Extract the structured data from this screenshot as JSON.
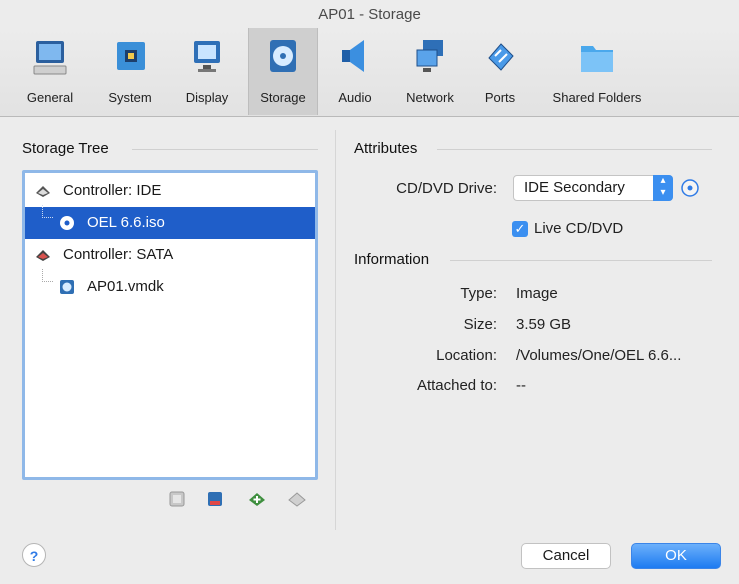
{
  "window": {
    "title": "AP01 - Storage"
  },
  "toolbar": {
    "items": [
      {
        "label": "General",
        "icon": "monitor-general-icon"
      },
      {
        "label": "System",
        "icon": "chip-icon"
      },
      {
        "label": "Display",
        "icon": "display-icon"
      },
      {
        "label": "Storage",
        "icon": "disk-icon",
        "active": true
      },
      {
        "label": "Audio",
        "icon": "speaker-icon"
      },
      {
        "label": "Network",
        "icon": "network-icon"
      },
      {
        "label": "Ports",
        "icon": "plug-icon"
      },
      {
        "label": "Shared Folders",
        "icon": "folder-icon"
      }
    ]
  },
  "storage_tree": {
    "heading": "Storage Tree",
    "rows": [
      {
        "label": "Controller: IDE",
        "icon": "ide-controller-icon"
      },
      {
        "label": "OEL 6.6.iso",
        "icon": "optical-disc-icon",
        "selected": true
      },
      {
        "label": "Controller: SATA",
        "icon": "sata-controller-icon"
      },
      {
        "label": "AP01.vmdk",
        "icon": "hard-disk-icon"
      }
    ],
    "buttons": [
      "add-controller-icon",
      "remove-controller-icon",
      "add-attachment-icon",
      "remove-attachment-icon"
    ]
  },
  "attributes": {
    "heading": "Attributes",
    "cd_drive_label": "CD/DVD Drive:",
    "cd_drive_value": "IDE Secondary",
    "live_cd_label": "Live CD/DVD",
    "live_cd_checked": true
  },
  "information": {
    "heading": "Information",
    "type_label": "Type:",
    "type_value": "Image",
    "size_label": "Size:",
    "size_value": "3.59 GB",
    "location_label": "Location:",
    "location_value": "/Volumes/One/OEL 6.6...",
    "attached_label": "Attached to:",
    "attached_value": "--"
  },
  "footer": {
    "help": "?",
    "cancel": "Cancel",
    "ok": "OK"
  },
  "colors": {
    "accent": "#1f5ec9",
    "button_blue": "#3b8ff0"
  }
}
